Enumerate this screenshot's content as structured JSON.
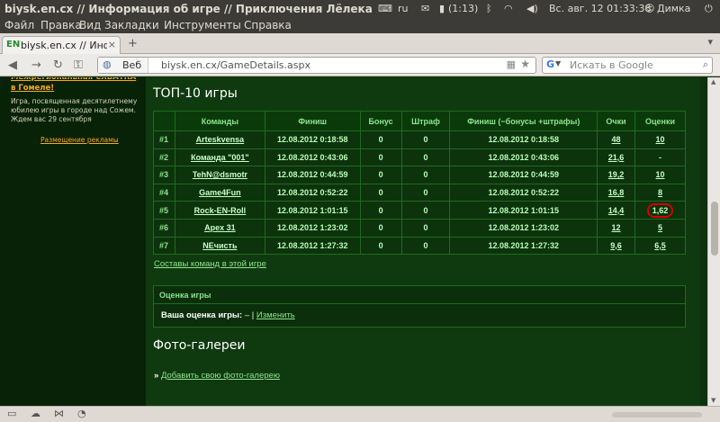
{
  "window": {
    "title": "biysk.en.cx // Информация об игре // Приключения Лёлека и Болека - Mozilla Firefox"
  },
  "tray": {
    "keyboard_layout": "ru",
    "battery": "(1:13)",
    "datetime": "Вс. авг. 12 01:33:38",
    "user": "Димка"
  },
  "menu": {
    "items": [
      "Файл",
      "Правка",
      "Вид",
      "Закладки",
      "Инструменты",
      "Справка"
    ]
  },
  "tab": {
    "favicon": "EN",
    "label": "biysk.en.cx // Инф…",
    "close": "×",
    "new_tab": "+"
  },
  "nav": {
    "identity_label": "Веб",
    "url": "biysk.en.cx/GameDetails.aspx",
    "search_placeholder": "Искать в Google"
  },
  "ad": {
    "title": "Межрегиональная СХВАТКА в Гомеле!",
    "text": "Игра, посвященная десятилетнему юбилею игры в городе над Сожем. Ждем вас 29 сентября",
    "link": "Размещение рекламы"
  },
  "top10": {
    "heading": "ТОП-10 игры",
    "columns": [
      "",
      "Команды",
      "Финиш",
      "Бонус",
      "Штраф",
      "Финиш (−бонусы +штрафы)",
      "Очки",
      "Оценки"
    ],
    "rows": [
      {
        "rank": "#1",
        "team": "Arteskvensa",
        "finish": "12.08.2012 0:18:58",
        "bonus": "0",
        "penalty": "0",
        "net": "12.08.2012 0:18:58",
        "points": "48",
        "rating": "10"
      },
      {
        "rank": "#2",
        "team": "Команда \"001\"",
        "finish": "12.08.2012 0:43:06",
        "bonus": "0",
        "penalty": "0",
        "net": "12.08.2012 0:43:06",
        "points": "21,6",
        "rating": "-"
      },
      {
        "rank": "#3",
        "team": "TehN@dsmotr",
        "finish": "12.08.2012 0:44:59",
        "bonus": "0",
        "penalty": "0",
        "net": "12.08.2012 0:44:59",
        "points": "19,2",
        "rating": "10"
      },
      {
        "rank": "#4",
        "team": "Game4Fun",
        "finish": "12.08.2012 0:52:22",
        "bonus": "0",
        "penalty": "0",
        "net": "12.08.2012 0:52:22",
        "points": "16,8",
        "rating": "8"
      },
      {
        "rank": "#5",
        "team": "Rock-EN-Roll",
        "finish": "12.08.2012 1:01:15",
        "bonus": "0",
        "penalty": "0",
        "net": "12.08.2012 1:01:15",
        "points": "14,4",
        "rating": "1,62"
      },
      {
        "rank": "#6",
        "team": "Apex 31",
        "finish": "12.08.2012 1:23:02",
        "bonus": "0",
        "penalty": "0",
        "net": "12.08.2012 1:23:02",
        "points": "12",
        "rating": "5"
      },
      {
        "rank": "#7",
        "team": "NEчисть",
        "finish": "12.08.2012 1:27:32",
        "bonus": "0",
        "penalty": "0",
        "net": "12.08.2012 1:27:32",
        "points": "9,6",
        "rating": "6,5"
      }
    ]
  },
  "teams_link": "Составы команд в этой игре",
  "rating_box": {
    "title": "Оценка игры",
    "label": "Ваша оценка игры:",
    "value": "–",
    "sep": "|",
    "change": "Изменить"
  },
  "gallery": {
    "heading": "Фото-галереи",
    "arrow": "»",
    "add_link": "Добавить свою фото-галерею"
  }
}
